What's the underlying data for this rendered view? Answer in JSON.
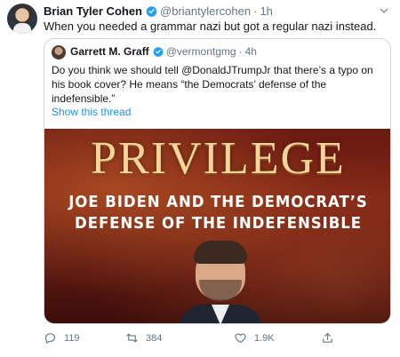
{
  "tweet": {
    "author_name": "Brian Tyler Cohen",
    "handle": "@briantylercohen",
    "time": "1h",
    "text": "When you needed a grammar nazi but got a regular nazi instead.",
    "dot": "·"
  },
  "quoted": {
    "author_name": "Garrett M. Graff",
    "handle": "@vermontgmg",
    "time": "4h",
    "dot": "·",
    "text": "Do you think we should tell @DonaldJTrumpJr that there’s a typo on his book cover? He means “the Democrats’ defense of the indefensible.”",
    "show_thread": "Show this thread",
    "cover": {
      "title": "PRIVILEGE",
      "subtitle_line1": "JOE BIDEN AND THE DEMOCRAT’S",
      "subtitle_line2": "DEFENSE OF THE INDEFENSIBLE"
    }
  },
  "actions": {
    "reply_count": "119",
    "retweet_count": "384",
    "like_count": "1.9K"
  },
  "colors": {
    "accent": "#1b95e0",
    "text_primary": "#14171a",
    "text_secondary": "#657786",
    "border": "#ccd6dd",
    "verified": "#1da1f2"
  },
  "icons": {
    "verified": "verified-badge-icon",
    "caret": "chevron-down-icon",
    "reply": "reply-icon",
    "retweet": "retweet-icon",
    "like": "heart-icon",
    "share": "share-icon"
  }
}
